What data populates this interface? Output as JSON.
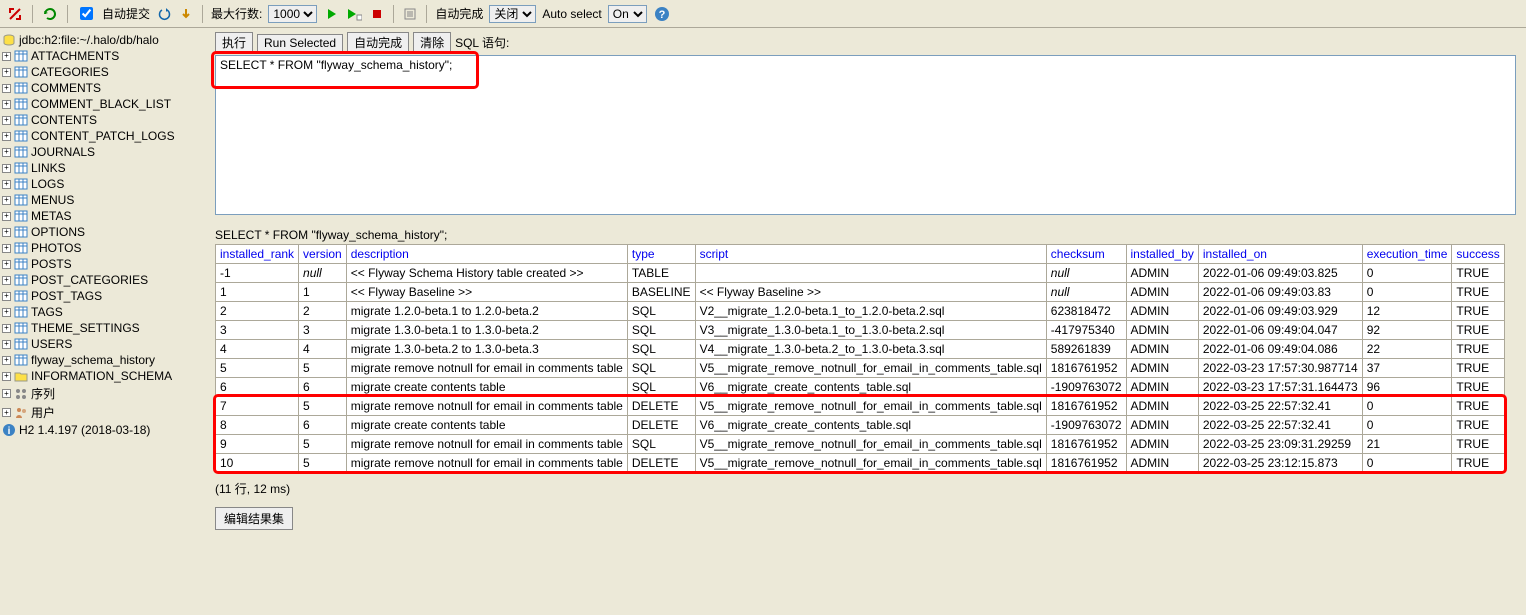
{
  "toolbar": {
    "auto_commit_label": "自动提交",
    "max_rows_label": "最大行数:",
    "max_rows_value": "1000",
    "auto_complete_label": "自动完成",
    "auto_complete_value": "关闭",
    "auto_select_label": "Auto select",
    "auto_select_value": "On"
  },
  "sidebar": {
    "conn": "jdbc:h2:file:~/.halo/db/halo",
    "tables": [
      "ATTACHMENTS",
      "CATEGORIES",
      "COMMENTS",
      "COMMENT_BLACK_LIST",
      "CONTENTS",
      "CONTENT_PATCH_LOGS",
      "JOURNALS",
      "LINKS",
      "LOGS",
      "MENUS",
      "METAS",
      "OPTIONS",
      "PHOTOS",
      "POSTS",
      "POST_CATEGORIES",
      "POST_TAGS",
      "TAGS",
      "THEME_SETTINGS",
      "USERS",
      "flyway_schema_history"
    ],
    "schema": "INFORMATION_SCHEMA",
    "sequences": "序列",
    "users": "用户",
    "version": "H2 1.4.197 (2018-03-18)"
  },
  "buttons": {
    "run": "执行",
    "run_selected": "Run Selected",
    "auto_complete": "自动完成",
    "clear": "清除",
    "sql_label": "SQL 语句:"
  },
  "sql": {
    "value": "SELECT * FROM \"flyway_schema_history\";",
    "echo": "SELECT * FROM \"flyway_schema_history\";"
  },
  "columns": [
    "installed_rank",
    "version",
    "description",
    "type",
    "script",
    "checksum",
    "installed_by",
    "installed_on",
    "execution_time",
    "success"
  ],
  "rows": [
    {
      "installed_rank": "-1",
      "version": "null",
      "description": "<< Flyway Schema History table created >>",
      "type": "TABLE",
      "script": "",
      "checksum": "null",
      "installed_by": "ADMIN",
      "installed_on": "2022-01-06 09:49:03.825",
      "execution_time": "0",
      "success": "TRUE"
    },
    {
      "installed_rank": "1",
      "version": "1",
      "description": "<< Flyway Baseline >>",
      "type": "BASELINE",
      "script": "<< Flyway Baseline >>",
      "checksum": "null",
      "installed_by": "ADMIN",
      "installed_on": "2022-01-06 09:49:03.83",
      "execution_time": "0",
      "success": "TRUE"
    },
    {
      "installed_rank": "2",
      "version": "2",
      "description": "migrate 1.2.0-beta.1 to 1.2.0-beta.2",
      "type": "SQL",
      "script": "V2__migrate_1.2.0-beta.1_to_1.2.0-beta.2.sql",
      "checksum": "623818472",
      "installed_by": "ADMIN",
      "installed_on": "2022-01-06 09:49:03.929",
      "execution_time": "12",
      "success": "TRUE"
    },
    {
      "installed_rank": "3",
      "version": "3",
      "description": "migrate 1.3.0-beta.1 to 1.3.0-beta.2",
      "type": "SQL",
      "script": "V3__migrate_1.3.0-beta.1_to_1.3.0-beta.2.sql",
      "checksum": "-417975340",
      "installed_by": "ADMIN",
      "installed_on": "2022-01-06 09:49:04.047",
      "execution_time": "92",
      "success": "TRUE"
    },
    {
      "installed_rank": "4",
      "version": "4",
      "description": "migrate 1.3.0-beta.2 to 1.3.0-beta.3",
      "type": "SQL",
      "script": "V4__migrate_1.3.0-beta.2_to_1.3.0-beta.3.sql",
      "checksum": "589261839",
      "installed_by": "ADMIN",
      "installed_on": "2022-01-06 09:49:04.086",
      "execution_time": "22",
      "success": "TRUE"
    },
    {
      "installed_rank": "5",
      "version": "5",
      "description": "migrate remove notnull for email in comments table",
      "type": "SQL",
      "script": "V5__migrate_remove_notnull_for_email_in_comments_table.sql",
      "checksum": "1816761952",
      "installed_by": "ADMIN",
      "installed_on": "2022-03-23 17:57:30.987714",
      "execution_time": "37",
      "success": "TRUE"
    },
    {
      "installed_rank": "6",
      "version": "6",
      "description": "migrate create contents table",
      "type": "SQL",
      "script": "V6__migrate_create_contents_table.sql",
      "checksum": "-1909763072",
      "installed_by": "ADMIN",
      "installed_on": "2022-03-23 17:57:31.164473",
      "execution_time": "96",
      "success": "TRUE"
    },
    {
      "installed_rank": "7",
      "version": "5",
      "description": "migrate remove notnull for email in comments table",
      "type": "DELETE",
      "script": "V5__migrate_remove_notnull_for_email_in_comments_table.sql",
      "checksum": "1816761952",
      "installed_by": "ADMIN",
      "installed_on": "2022-03-25 22:57:32.41",
      "execution_time": "0",
      "success": "TRUE"
    },
    {
      "installed_rank": "8",
      "version": "6",
      "description": "migrate create contents table",
      "type": "DELETE",
      "script": "V6__migrate_create_contents_table.sql",
      "checksum": "-1909763072",
      "installed_by": "ADMIN",
      "installed_on": "2022-03-25 22:57:32.41",
      "execution_time": "0",
      "success": "TRUE"
    },
    {
      "installed_rank": "9",
      "version": "5",
      "description": "migrate remove notnull for email in comments table",
      "type": "SQL",
      "script": "V5__migrate_remove_notnull_for_email_in_comments_table.sql",
      "checksum": "1816761952",
      "installed_by": "ADMIN",
      "installed_on": "2022-03-25 23:09:31.29259",
      "execution_time": "21",
      "success": "TRUE"
    },
    {
      "installed_rank": "10",
      "version": "5",
      "description": "migrate remove notnull for email in comments table",
      "type": "DELETE",
      "script": "V5__migrate_remove_notnull_for_email_in_comments_table.sql",
      "checksum": "1816761952",
      "installed_by": "ADMIN",
      "installed_on": "2022-03-25 23:12:15.873",
      "execution_time": "0",
      "success": "TRUE"
    }
  ],
  "rows_info": "(11 行, 12 ms)",
  "edit_label": "编辑结果集"
}
